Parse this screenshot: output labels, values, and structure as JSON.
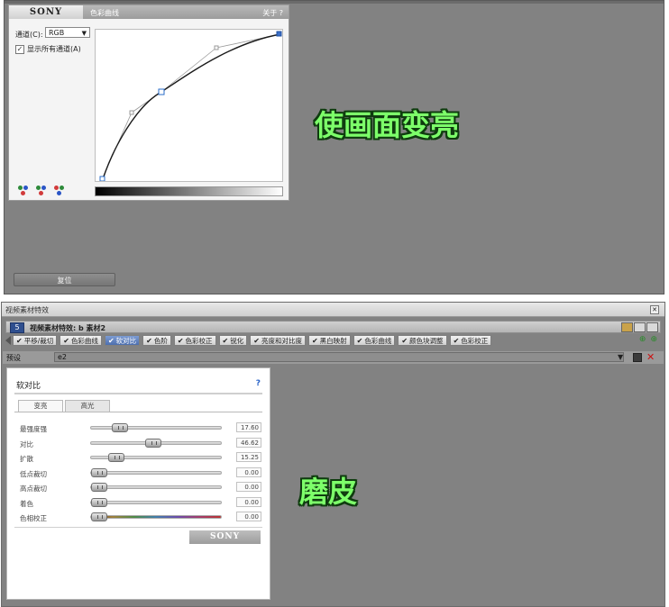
{
  "top_panel": {
    "plugin": {
      "logo": "SONY",
      "title": "色彩曲线",
      "about": "关于 ?",
      "channel_label": "通道(C):",
      "channel_value": "RGB",
      "show_all_label": "显示所有通道(A)",
      "show_all_checked": "✓"
    },
    "channel_icon_names": [
      "rgb-channel-icon",
      "red-channel-icon",
      "green-channel-icon"
    ],
    "reset_label": "复位",
    "annotation": "使画面变亮",
    "annotation_color": "#7dff6a"
  },
  "bottom_window": {
    "title": "视频素材特效",
    "close": "✕",
    "track": {
      "number": "5",
      "title": "视频素材特效: b 素材2"
    },
    "effects": [
      {
        "label": "平移/裁切",
        "active": false
      },
      {
        "label": "色彩曲线",
        "active": false
      },
      {
        "label": "软对比",
        "active": true
      },
      {
        "label": "色阶",
        "active": false
      },
      {
        "label": "色彩校正",
        "active": false
      },
      {
        "label": "锐化",
        "active": false
      },
      {
        "label": "亮度和对比度",
        "active": false
      },
      {
        "label": "黑白映射",
        "active": false
      },
      {
        "label": "色彩曲线",
        "active": false
      },
      {
        "label": "颜色块调整",
        "active": false
      },
      {
        "label": "色彩校正",
        "active": false
      }
    ],
    "preset": {
      "label": "预设",
      "value": "e2"
    },
    "contrast_panel": {
      "title": "软对比",
      "help": "?",
      "tabs": [
        "变亮",
        "高光"
      ],
      "selected_tab": 0,
      "params": [
        {
          "label": "最强度强",
          "value": "17.60",
          "level": 0.18,
          "hue": false
        },
        {
          "label": "对比",
          "value": "46.62",
          "level": 0.47,
          "hue": false
        },
        {
          "label": "扩散",
          "value": "15.25",
          "level": 0.15,
          "hue": false
        },
        {
          "label": "低点裁切",
          "value": "0.00",
          "level": 0.0,
          "hue": false
        },
        {
          "label": "高点裁切",
          "value": "0.00",
          "level": 0.0,
          "hue": false
        },
        {
          "label": "着色",
          "value": "0.00",
          "level": 0.0,
          "hue": false
        },
        {
          "label": "色相校正",
          "value": "0.00",
          "level": 0.0,
          "hue": true
        }
      ],
      "logo": "SONY"
    },
    "annotation": "磨皮",
    "annotation_color": "#7dff6a"
  }
}
